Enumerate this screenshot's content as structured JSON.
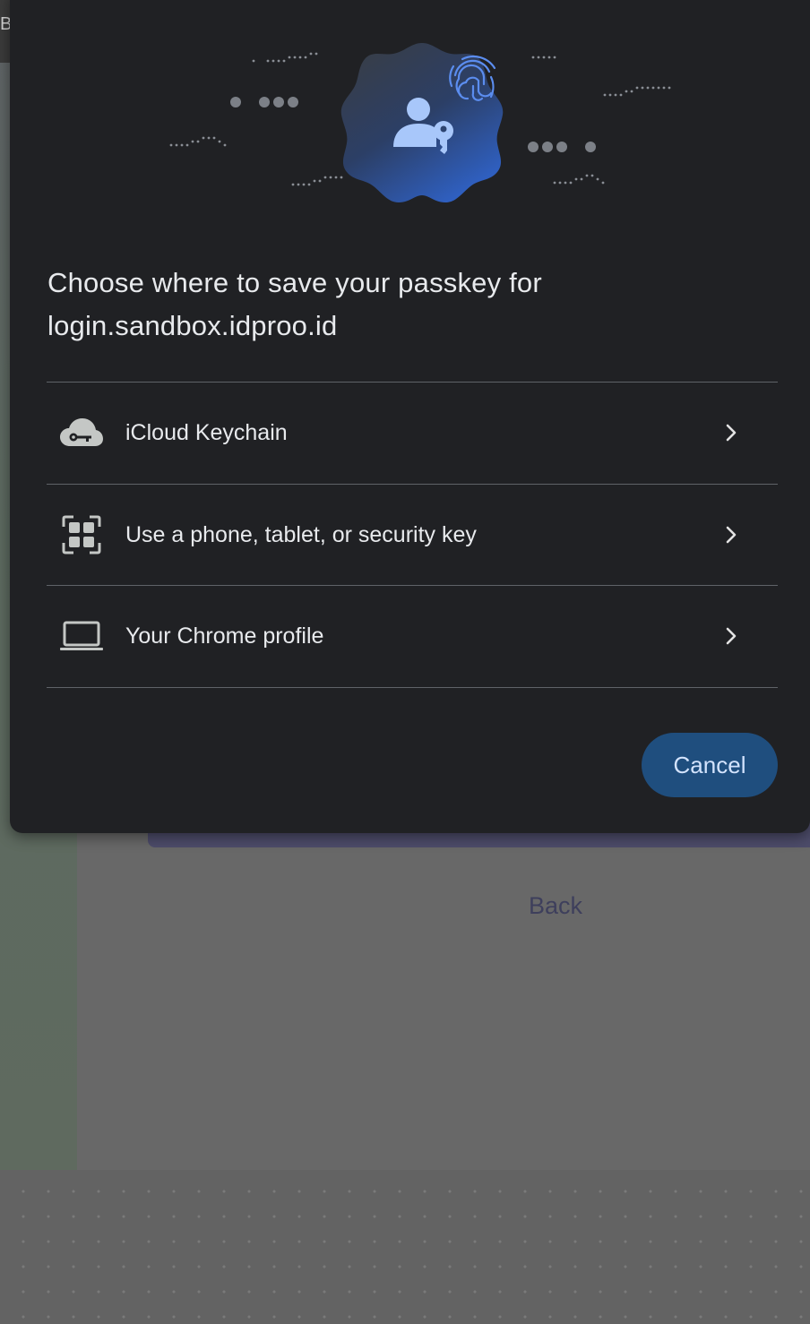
{
  "background": {
    "corner_letter": "B",
    "back_link": "Back"
  },
  "dialog": {
    "title": "Choose where to save your passkey for login.sandbox.idproo.id",
    "hero_icon": "passkey-person-key-fingerprint-icon",
    "options": [
      {
        "label": "iCloud Keychain",
        "icon": "cloud-key-icon"
      },
      {
        "label": "Use a phone, tablet, or security key",
        "icon": "qr-grid-icon"
      },
      {
        "label": "Your Chrome profile",
        "icon": "laptop-icon"
      }
    ],
    "cancel_label": "Cancel"
  },
  "colors": {
    "dialog_bg": "#202124",
    "text": "#e8eaed",
    "divider": "#5f6368",
    "button_bg": "#1f4e7e",
    "button_text": "#d3e3fd",
    "hero_gradient_from": "#3a3d42",
    "hero_gradient_to": "#2f5fbf"
  }
}
